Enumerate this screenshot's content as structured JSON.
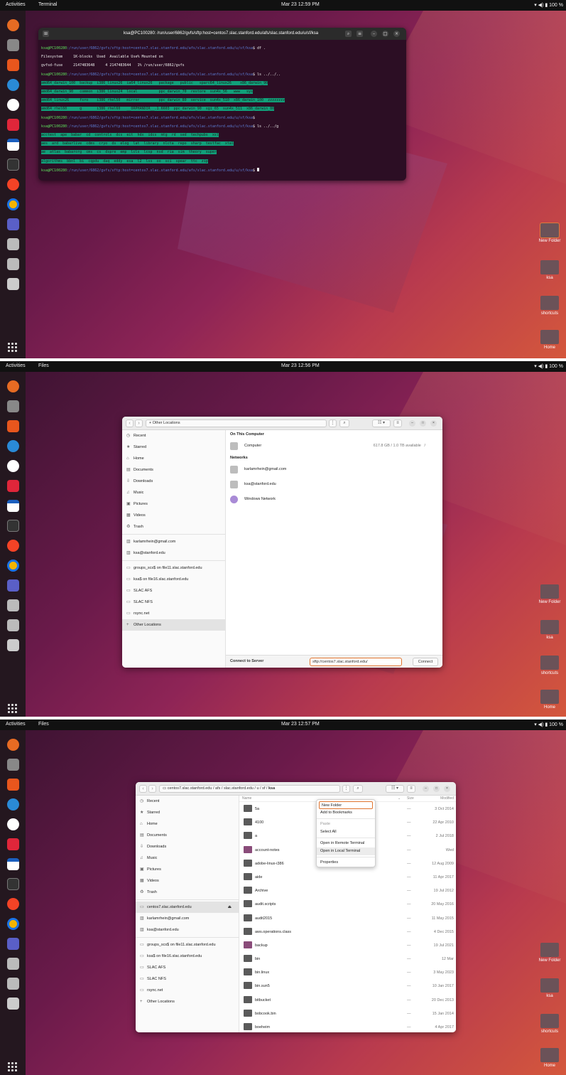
{
  "topbar": {
    "activities": "Activities",
    "screens": [
      {
        "app": "Terminal",
        "clock": "Mar 23  12:59 PM"
      },
      {
        "app": "Files",
        "clock": "Mar 23  12:56 PM"
      },
      {
        "app": "Files",
        "clock": "Mar 23  12:57 PM"
      }
    ],
    "tray": "100 %"
  },
  "desktop_icons": [
    "New Folder",
    "ksa",
    "shortcuts",
    "Home"
  ],
  "terminal": {
    "title": "ksa@PC100280: /run/user/6862/gvfs/sftp:host=centos7.slac.stanford.edu/afs/slac.stanford.edu/u/sf/ksa",
    "prompt_user": "ksa@PC100280",
    "prompt_path": ":/run/user/6862/gvfs/sftp:host=centos7.slac.stanford.edu/afs/slac.stanford.edu/u/sf/ksa",
    "cmd1": "$ df .",
    "df_header": "Filesystem     1K-blocks  Used  Available Use% Mounted on",
    "df_row": "gvfsd-fuse     2147483648     4 2147483644   1% /run/user/6862/gvfs",
    "cmd2": "$ ls ../../..",
    "ls1": [
      "amd64_darwin_100  backup  i386_linux26  ia64_linux26   package   public   sparc64_linux26    x86_darwin_90",
      "amd64_darwin_90   common  i386_linux24  local          ppc_darwin_70  restore  sun4x_56   www   sys",
      "amd64_linux26     fsro    i386_rhel50   mirror         ppc_darwin_80  service  sun4x_510  x86_darwin_100  zzzzzzzz",
      "amd64_rhel60      g       i386_rhel60   __ORPHANDIR__.1.6603  ppc_darwin_90  sgi_65  sun4x_511  x86_darwin_80"
    ],
    "cmd3": "$ ls ../../g",
    "ls2": [
      "acctest  ape  babar  cd  controls  dcs  eit  hdx  idcs  mtg  rd  sed  techpubs  xsl",
      "aes  ard  babarlive  cdms  cryo  ds  elog  lat  library  nlcta  repo  sharp  testfac  xtal",
      "ae  atlas  babarorg  cms  cs  dspre  emp  lcls  lcsp  nsd  ria  sim  theory  super",
      "algorithms  bbnl  bi  cqpdu  daq  eddy  esa  l2  lss  oo  sci  spear  ttc  zip"
    ]
  },
  "files_other": {
    "location": "Other Locations",
    "sidebar": [
      "Recent",
      "Starred",
      "Home",
      "Documents",
      "Downloads",
      "Music",
      "Pictures",
      "Videos",
      "Trash",
      "karlamrhein@gmail.com",
      "ksa@stanford.edu",
      "groups_scs$ on file11.slac.stanford.edu",
      "ksa$ on file16.slac.stanford.edu",
      "SLAC AFS",
      "SLAC NFS",
      "rsync.net",
      "Other Locations"
    ],
    "on_this_computer": "On This Computer",
    "computer": "Computer",
    "computer_space": "617.8 GB / 1.0 TB available",
    "computer_path": "/",
    "networks": "Networks",
    "network_items": [
      "karlamrhein@gmail.com",
      "ksa@stanford.edu",
      "Windows Network"
    ],
    "connect_label": "Connect to Server",
    "connect_value": "sftp://centos7.slac.stanford.edu/",
    "connect_button": "Connect"
  },
  "files_remote": {
    "path": [
      "centos7.slac.stanford.edu",
      "afs",
      "slac.stanford.edu",
      "u",
      "sf",
      "ksa"
    ],
    "sidebar_mount": "centos7.slac.stanford.edu",
    "col_name": "Name",
    "col_size": "Size",
    "col_modified": "Modified",
    "rows": [
      {
        "name": "5a",
        "size": "—",
        "modified": "3 Oct 2014",
        "type": "folder"
      },
      {
        "name": "4100",
        "size": "—",
        "modified": "22 Apr 2010",
        "type": "folder"
      },
      {
        "name": "a",
        "size": "—",
        "modified": "2 Jul 2018",
        "type": "folder"
      },
      {
        "name": "account-notes",
        "size": "—",
        "modified": "Wed",
        "type": "file"
      },
      {
        "name": "adobe-linux-i386",
        "size": "—",
        "modified": "12 Aug 2009",
        "type": "folder"
      },
      {
        "name": "aide",
        "size": "—",
        "modified": "11 Apr 2017",
        "type": "folder"
      },
      {
        "name": "Archive",
        "size": "—",
        "modified": "19 Jul 2012",
        "type": "folder"
      },
      {
        "name": "audit.scripts",
        "size": "—",
        "modified": "20 May 2016",
        "type": "folder"
      },
      {
        "name": "audit2015",
        "size": "—",
        "modified": "11 May 2015",
        "type": "folder"
      },
      {
        "name": "aws.operations.class",
        "size": "—",
        "modified": "4 Dec 2015",
        "type": "folder"
      },
      {
        "name": "backup",
        "size": "—",
        "modified": "19 Jul 2021",
        "type": "file"
      },
      {
        "name": "bin",
        "size": "—",
        "modified": "12 Mar",
        "type": "folder"
      },
      {
        "name": "bin.linux",
        "size": "—",
        "modified": "3 May 2023",
        "type": "folder"
      },
      {
        "name": "bin.sun5",
        "size": "—",
        "modified": "10 Jan 2017",
        "type": "folder"
      },
      {
        "name": "bitbucket",
        "size": "—",
        "modified": "20 Dec 2013",
        "type": "folder"
      },
      {
        "name": "bobcook.bin",
        "size": "—",
        "modified": "15 Jan 2014",
        "type": "folder"
      },
      {
        "name": "boeheim",
        "size": "—",
        "modified": "4 Apr 2017",
        "type": "folder"
      }
    ],
    "context_menu": [
      "New Folder",
      "Add to Bookmarks",
      "Paste",
      "Select All",
      "Open in Remote Terminal",
      "Open in Local Terminal",
      "Properties"
    ]
  },
  "colors": {
    "accent": "#e0732d",
    "terminal_bg": "#2c0e24",
    "prompt": "#5ee05e",
    "highlight": "#11a07a"
  }
}
